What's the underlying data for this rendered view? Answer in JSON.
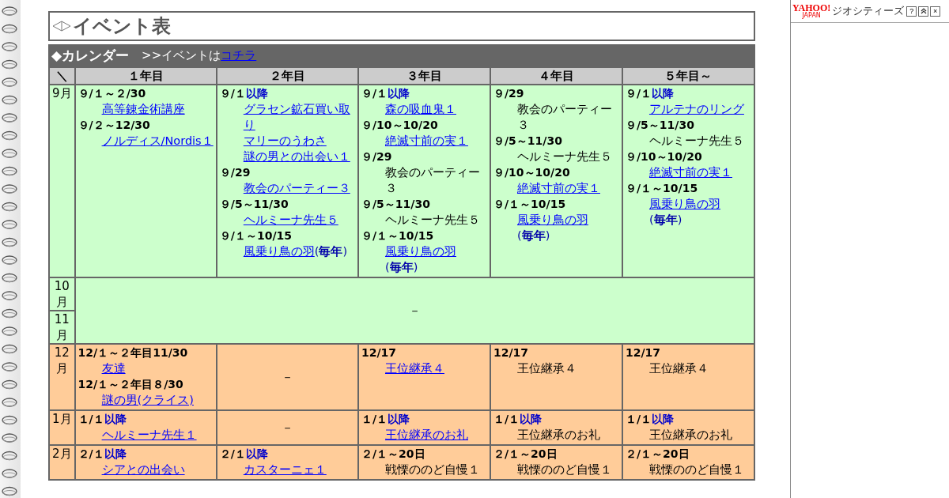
{
  "title": "イベント表",
  "calendar": {
    "heading": "◆カレンダー",
    "lead": ">>イベントは",
    "link": "コチラ"
  },
  "columns": [
    "＼",
    "１年目",
    "２年目",
    "３年目",
    "４年目",
    "５年目～"
  ],
  "rows": [
    {
      "month": "9月",
      "color": "#ccffcc",
      "cells": [
        {
          "kind": "events",
          "entries": [
            {
              "date": "９/１～２/30",
              "title": "高等錬金術講座",
              "link": true
            },
            {
              "date": "９/２～12/30",
              "title": "ノルディス/Nordis１",
              "link": true
            }
          ]
        },
        {
          "kind": "events",
          "entries": [
            {
              "date": "９/１",
              "date_note": "以降",
              "title": "グラセン鉱石買い取り",
              "link": true
            },
            {
              "title": "マリーのうわさ",
              "link": true
            },
            {
              "title": "謎の男との出会い１",
              "link": true
            },
            {
              "date": "９/29",
              "title": "教会のパーティー３",
              "link": true
            },
            {
              "date": "９/5～11/30",
              "title": "ヘルミーナ先生５",
              "link": true
            },
            {
              "date": "９/１～10/15",
              "title": "風乗り鳥の羽",
              "link": true,
              "note": "(**毎年**)"
            }
          ]
        },
        {
          "kind": "events",
          "entries": [
            {
              "date": "９/１",
              "date_note": "以降",
              "title": "森の吸血鬼１",
              "link": true
            },
            {
              "date": "９/10～10/20",
              "title": "絶滅寸前の実１",
              "link": true
            },
            {
              "date": "９/29",
              "title": "教会のパーティー３",
              "link": false
            },
            {
              "date": "９/5～11/30",
              "title": "ヘルミーナ先生５",
              "link": false
            },
            {
              "date": "９/１～10/15",
              "title": "風乗り鳥の羽",
              "link": true,
              "note": "(**毎年**)"
            }
          ]
        },
        {
          "kind": "events",
          "entries": [
            {
              "date": "９/29",
              "title": "教会のパーティー３",
              "link": false
            },
            {
              "date": "９/5～11/30",
              "title": "ヘルミーナ先生５",
              "link": false
            },
            {
              "date": "９/10～10/20",
              "title": "絶滅寸前の実１",
              "link": true
            },
            {
              "date": "９/１～10/15",
              "title": "風乗り鳥の羽",
              "link": true,
              "note": "(**毎年**)"
            }
          ]
        },
        {
          "kind": "events",
          "entries": [
            {
              "date": "９/１",
              "date_note": "以降",
              "title": "アルテナのリング",
              "link": true
            },
            {
              "date": "９/5～11/30",
              "title": "ヘルミーナ先生５",
              "link": false
            },
            {
              "date": "９/10～10/20",
              "title": "絶滅寸前の実１",
              "link": true
            },
            {
              "date": "９/１～10/15",
              "title": "風乗り鳥の羽",
              "link": true,
              "note": "(**毎年**)"
            }
          ]
        }
      ]
    },
    {
      "month": "10月",
      "color": "#ccffcc",
      "cells": [
        {
          "kind": "span",
          "text": "－"
        }
      ]
    },
    {
      "month": "11月",
      "color": "#ccffcc"
    },
    {
      "month": "12月",
      "color": "#ffcc99",
      "cells": [
        {
          "kind": "events",
          "entries": [
            {
              "date": "12/１～２年目11/30",
              "title": "友達",
              "link": true
            },
            {
              "date": "12/１～２年目８/30",
              "title": "謎の男(クライス)",
              "link": true
            }
          ]
        },
        {
          "kind": "empty",
          "text": "－"
        },
        {
          "kind": "events",
          "entries": [
            {
              "date": "12/17",
              "title": "王位継承４",
              "link": true
            }
          ]
        },
        {
          "kind": "events",
          "entries": [
            {
              "date": "12/17",
              "title": "王位継承４",
              "link": false
            }
          ]
        },
        {
          "kind": "events",
          "entries": [
            {
              "date": "12/17",
              "title": "王位継承４",
              "link": false
            }
          ]
        }
      ]
    },
    {
      "month": "1月",
      "color": "#ffcc99",
      "cells": [
        {
          "kind": "events",
          "entries": [
            {
              "date": "１/１",
              "date_note": "以降",
              "title": "ヘルミーナ先生１",
              "link": true
            }
          ]
        },
        {
          "kind": "empty",
          "text": "－"
        },
        {
          "kind": "events",
          "entries": [
            {
              "date": "１/１",
              "date_note": "以降",
              "title": "王位継承のお礼",
              "link": true
            }
          ]
        },
        {
          "kind": "events",
          "entries": [
            {
              "date": "１/１",
              "date_note": "以降",
              "title": "王位継承のお礼",
              "link": false
            }
          ]
        },
        {
          "kind": "events",
          "entries": [
            {
              "date": "１/１",
              "date_note": "以降",
              "title": "王位継承のお礼",
              "link": false
            }
          ]
        }
      ]
    },
    {
      "month": "2月",
      "color": "#ffcc99",
      "cells": [
        {
          "kind": "events",
          "entries": [
            {
              "date": "２/１",
              "date_note": "以降",
              "title": "シアとの出会い",
              "link": true
            }
          ]
        },
        {
          "kind": "events",
          "entries": [
            {
              "date": "２/１",
              "date_note": "以降",
              "title": "カスターニェ１",
              "link": true
            }
          ]
        },
        {
          "kind": "events",
          "entries": [
            {
              "date": "２/１～20日",
              "title": "戦慄ののど自慢１",
              "link": false
            }
          ]
        },
        {
          "kind": "events",
          "entries": [
            {
              "date": "２/１～20日",
              "title": "戦慄ののど自慢１",
              "link": false
            }
          ]
        },
        {
          "kind": "events",
          "entries": [
            {
              "date": "２/１～20日",
              "title": "戦慄ののど自慢１",
              "link": false
            }
          ]
        }
      ]
    }
  ],
  "sidebar": {
    "logo": "YAHOO!",
    "logo_sub": "JAPAN",
    "service": "ジオシティーズ",
    "help": "?",
    "close": "×"
  }
}
